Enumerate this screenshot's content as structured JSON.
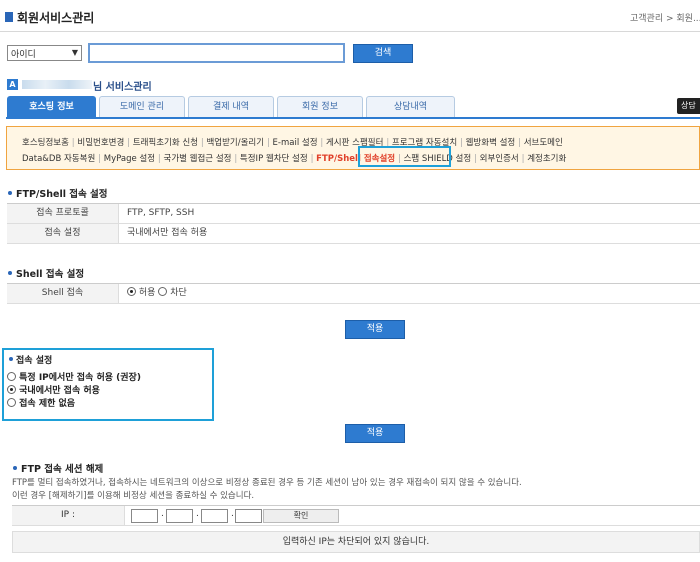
{
  "header": {
    "title": "회원서비스관리",
    "breadcrumb": "고객관리 > 회원..."
  },
  "search": {
    "select_value": "아이디",
    "input_value": "",
    "button_label": "검색"
  },
  "user": {
    "badge": "A",
    "suffix": "님 서비스관리"
  },
  "tabs": [
    {
      "label": "호스팅 정보",
      "active": true
    },
    {
      "label": "도메인 관리",
      "active": false
    },
    {
      "label": "결제 내역",
      "active": false
    },
    {
      "label": "회원 정보",
      "active": false
    },
    {
      "label": "상담내역",
      "active": false
    }
  ],
  "tab_right_label": "상담",
  "submenu": {
    "row1": [
      "호스팅정보홈",
      "비밀번호변경",
      "트래픽초기화 신청",
      "백업받기/올리기",
      "E-mail 설정",
      "게시판 스팸필터",
      "프로그램 자동설치",
      "웹방화벽 설정",
      "서브도메인"
    ],
    "row2_before": [
      "Data&DB 자동복원",
      "MyPage 설정",
      "국가별 웹접근 설정",
      "특정IP 웹차단 설정"
    ],
    "row2_active": "FTP/Shell 접속설정",
    "row2_after": [
      "스팸 SHIELD 설정",
      "외부인증서",
      "계정초기화"
    ]
  },
  "ftp_shell": {
    "title": "FTP/Shell 접속 설정",
    "rows": [
      {
        "label": "접속 프로토콜",
        "value": "FTP, SFTP, SSH"
      },
      {
        "label": "접속 설정",
        "value": "국내에서만 접속 허용"
      }
    ]
  },
  "shell": {
    "title": "Shell 접속 설정",
    "label": "Shell 접속",
    "option_allow": "허용",
    "option_block": "차단",
    "selected": "allow"
  },
  "apply_label": "적용",
  "access": {
    "title": "접속 설정",
    "options": [
      "특정 IP에서만 접속 허용 (권장)",
      "국내에서만 접속 허용",
      "접속 제한 없음"
    ],
    "selected_index": 1
  },
  "session": {
    "title": "FTP 접속 세션 해제",
    "desc1": "FTP를 멀티 접속하였거나, 접속하시는 네트워크의 이상으로 비정상 종료된 경우 등 기존 세션이 남아 있는 경우 재접속이 되지 않을 수 있습니다.",
    "desc2": "이런 경우 [해제하기]를 이용해 비정상 세션을 종료하실 수 있습니다.",
    "ip_label": "IP :",
    "ip_values": [
      "",
      "",
      "",
      ""
    ],
    "confirm_label": "확인",
    "message": "입력하신 IP는 차단되어 있지 않습니다."
  }
}
